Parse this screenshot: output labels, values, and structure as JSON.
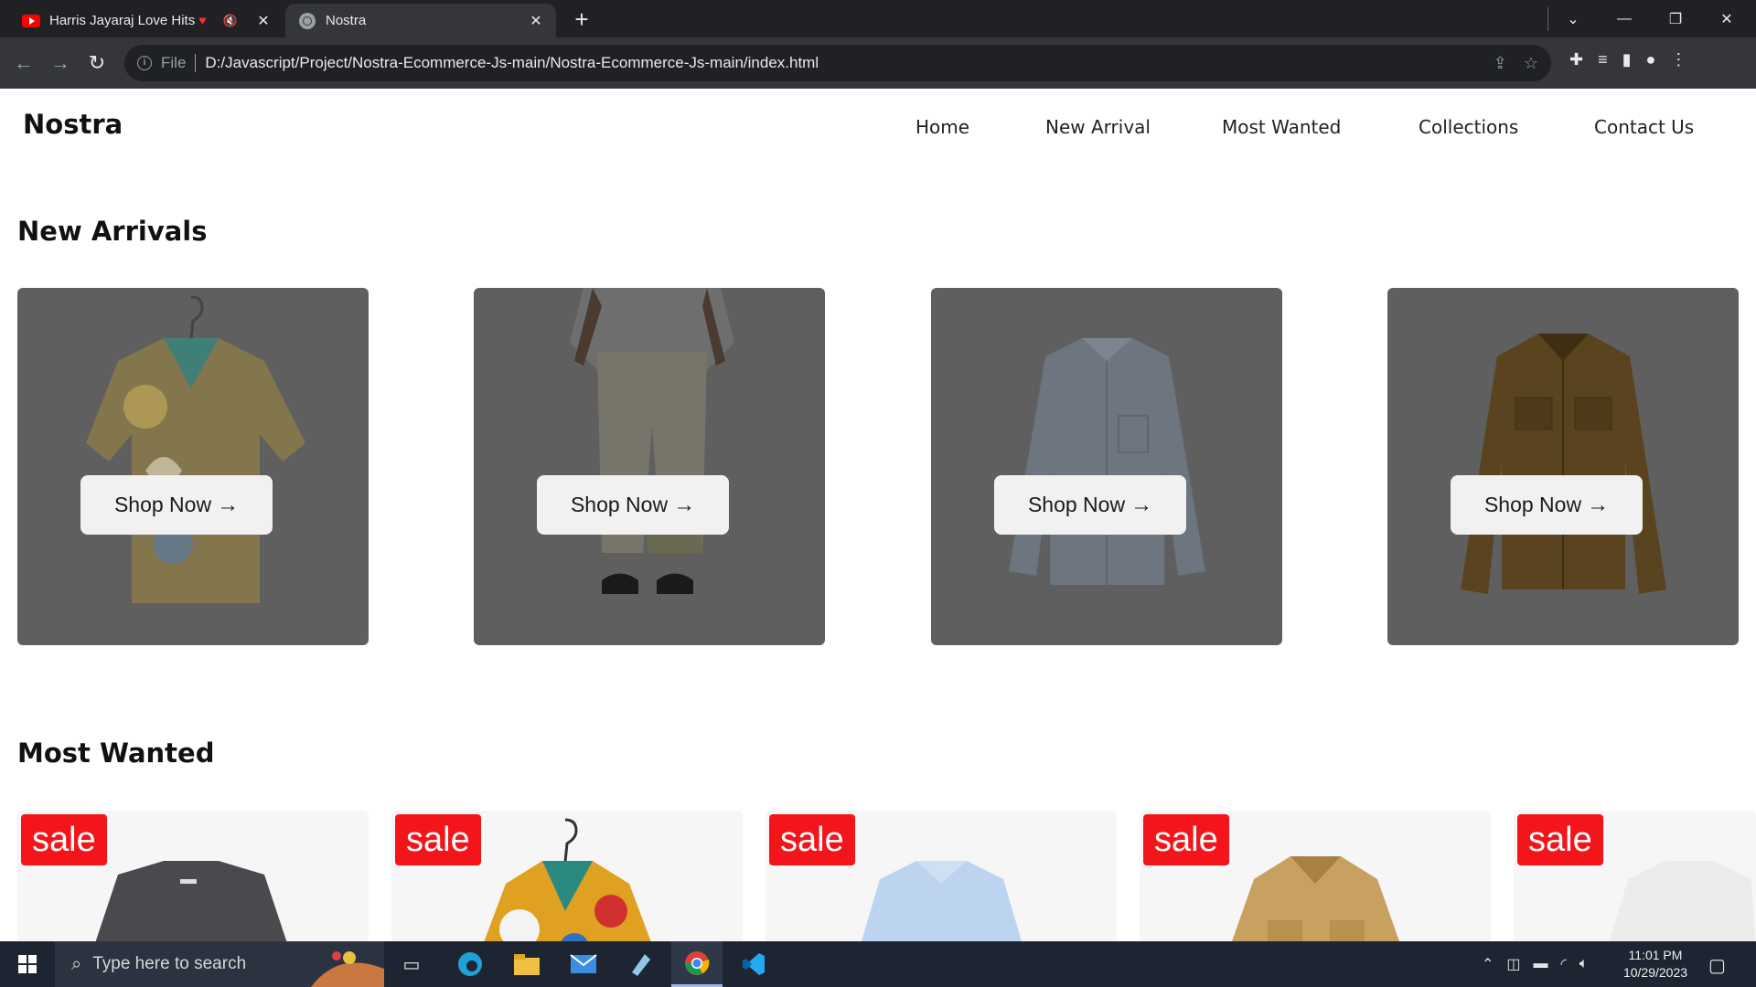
{
  "browser": {
    "tabs": [
      {
        "title": "Harris Jayaraj Love Hits",
        "active": false,
        "favicon": "youtube-icon",
        "audio": "muted"
      },
      {
        "title": "Nostra",
        "active": true,
        "favicon": "globe-icon"
      }
    ],
    "address_bar": {
      "scheme_label": "File",
      "url": "D:/Javascript/Project/Nostra-Ecommerce-Js-main/Nostra-Ecommerce-Js-main/index.html"
    }
  },
  "site": {
    "logo": "Nostra",
    "nav": [
      "Home",
      "New Arrival",
      "Most Wanted",
      "Collections",
      "Contact Us"
    ]
  },
  "new_arrivals": {
    "title": "New Arrivals",
    "button_label": "Shop Now",
    "items": [
      {
        "product": "floral printed shirt"
      },
      {
        "product": "linen trousers"
      },
      {
        "product": "light blue shirt"
      },
      {
        "product": "brown jacket"
      }
    ]
  },
  "most_wanted": {
    "title": "Most Wanted",
    "badge": "sale",
    "items": [
      {
        "product": "grey shirt"
      },
      {
        "product": "floral printed shirt"
      },
      {
        "product": "light blue shirt"
      },
      {
        "product": "tan jacket"
      },
      {
        "product": "white shirt"
      }
    ]
  },
  "taskbar": {
    "search_placeholder": "Type here to search",
    "time": "11:01 PM",
    "date": "10/29/2023"
  },
  "colors": {
    "accent_sale": "#f4151b",
    "card_overlay": "#5f5f5f",
    "chrome_dark": "#202124"
  }
}
